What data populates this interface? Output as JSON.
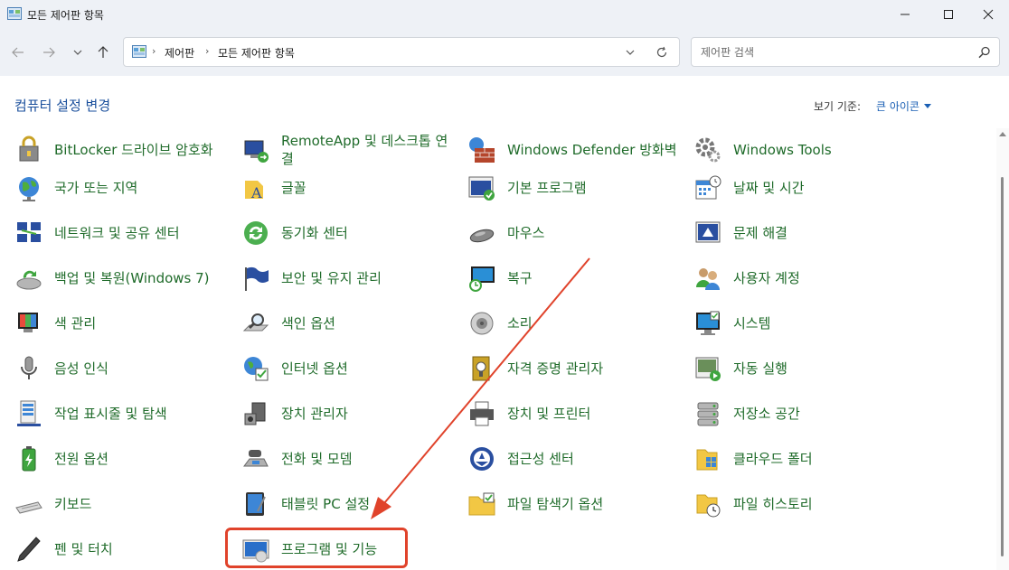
{
  "window": {
    "title": "모든 제어판 항목"
  },
  "nav": {
    "breadcrumbs": [
      "제어판",
      "모든 제어판 항목"
    ],
    "search_placeholder": "제어판 검색"
  },
  "header": {
    "title": "컴퓨터 설정 변경",
    "view_by_label": "보기 기준:",
    "view_by_value": "큰 아이콘"
  },
  "columns": [
    [
      {
        "label": "BitLocker 드라이브 암호화",
        "icon": "bitlocker-icon"
      },
      {
        "label": "국가 또는 지역",
        "icon": "globe-icon"
      },
      {
        "label": "네트워크 및 공유 센터",
        "icon": "network-icon"
      },
      {
        "label": "백업 및 복원(Windows 7)",
        "icon": "backup-icon"
      },
      {
        "label": "색 관리",
        "icon": "color-management-icon"
      },
      {
        "label": "음성 인식",
        "icon": "microphone-icon"
      },
      {
        "label": "작업 표시줄 및 탐색",
        "icon": "taskbar-icon"
      },
      {
        "label": "전원 옵션",
        "icon": "battery-icon"
      },
      {
        "label": "키보드",
        "icon": "keyboard-icon"
      },
      {
        "label": "펜 및 터치",
        "icon": "pen-icon"
      }
    ],
    [
      {
        "label": "RemoteApp 및 데스크톱 연결",
        "icon": "remoteapp-icon"
      },
      {
        "label": "글꼴",
        "icon": "font-icon"
      },
      {
        "label": "동기화 센터",
        "icon": "sync-icon"
      },
      {
        "label": "보안 및 유지 관리",
        "icon": "flag-icon"
      },
      {
        "label": "색인 옵션",
        "icon": "indexing-icon"
      },
      {
        "label": "인터넷 옵션",
        "icon": "internet-options-icon"
      },
      {
        "label": "장치 관리자",
        "icon": "device-manager-icon"
      },
      {
        "label": "전화 및 모뎀",
        "icon": "phone-modem-icon"
      },
      {
        "label": "태블릿 PC 설정",
        "icon": "tablet-icon"
      },
      {
        "label": "프로그램 및 기능",
        "icon": "programs-icon"
      }
    ],
    [
      {
        "label": "Windows Defender 방화벽",
        "icon": "firewall-icon"
      },
      {
        "label": "기본 프로그램",
        "icon": "default-programs-icon"
      },
      {
        "label": "마우스",
        "icon": "mouse-icon"
      },
      {
        "label": "복구",
        "icon": "recovery-icon"
      },
      {
        "label": "소리",
        "icon": "speaker-icon"
      },
      {
        "label": "자격 증명 관리자",
        "icon": "credential-icon"
      },
      {
        "label": "장치 및 프린터",
        "icon": "printer-icon"
      },
      {
        "label": "접근성 센터",
        "icon": "accessibility-icon"
      },
      {
        "label": "파일 탐색기 옵션",
        "icon": "folder-options-icon"
      }
    ],
    [
      {
        "label": "Windows Tools",
        "icon": "tools-icon"
      },
      {
        "label": "날짜 및 시간",
        "icon": "calendar-icon"
      },
      {
        "label": "문제 해결",
        "icon": "troubleshoot-icon"
      },
      {
        "label": "사용자 계정",
        "icon": "users-icon"
      },
      {
        "label": "시스템",
        "icon": "system-icon"
      },
      {
        "label": "자동 실행",
        "icon": "autoplay-icon"
      },
      {
        "label": "저장소 공간",
        "icon": "storage-icon"
      },
      {
        "label": "클라우드 폴더",
        "icon": "cloud-folder-icon"
      },
      {
        "label": "파일 히스토리",
        "icon": "file-history-icon"
      }
    ]
  ],
  "colors": {
    "link_green": "#1f6b2a",
    "title_blue": "#1a4f9c",
    "annotation_red": "#e0432b"
  }
}
